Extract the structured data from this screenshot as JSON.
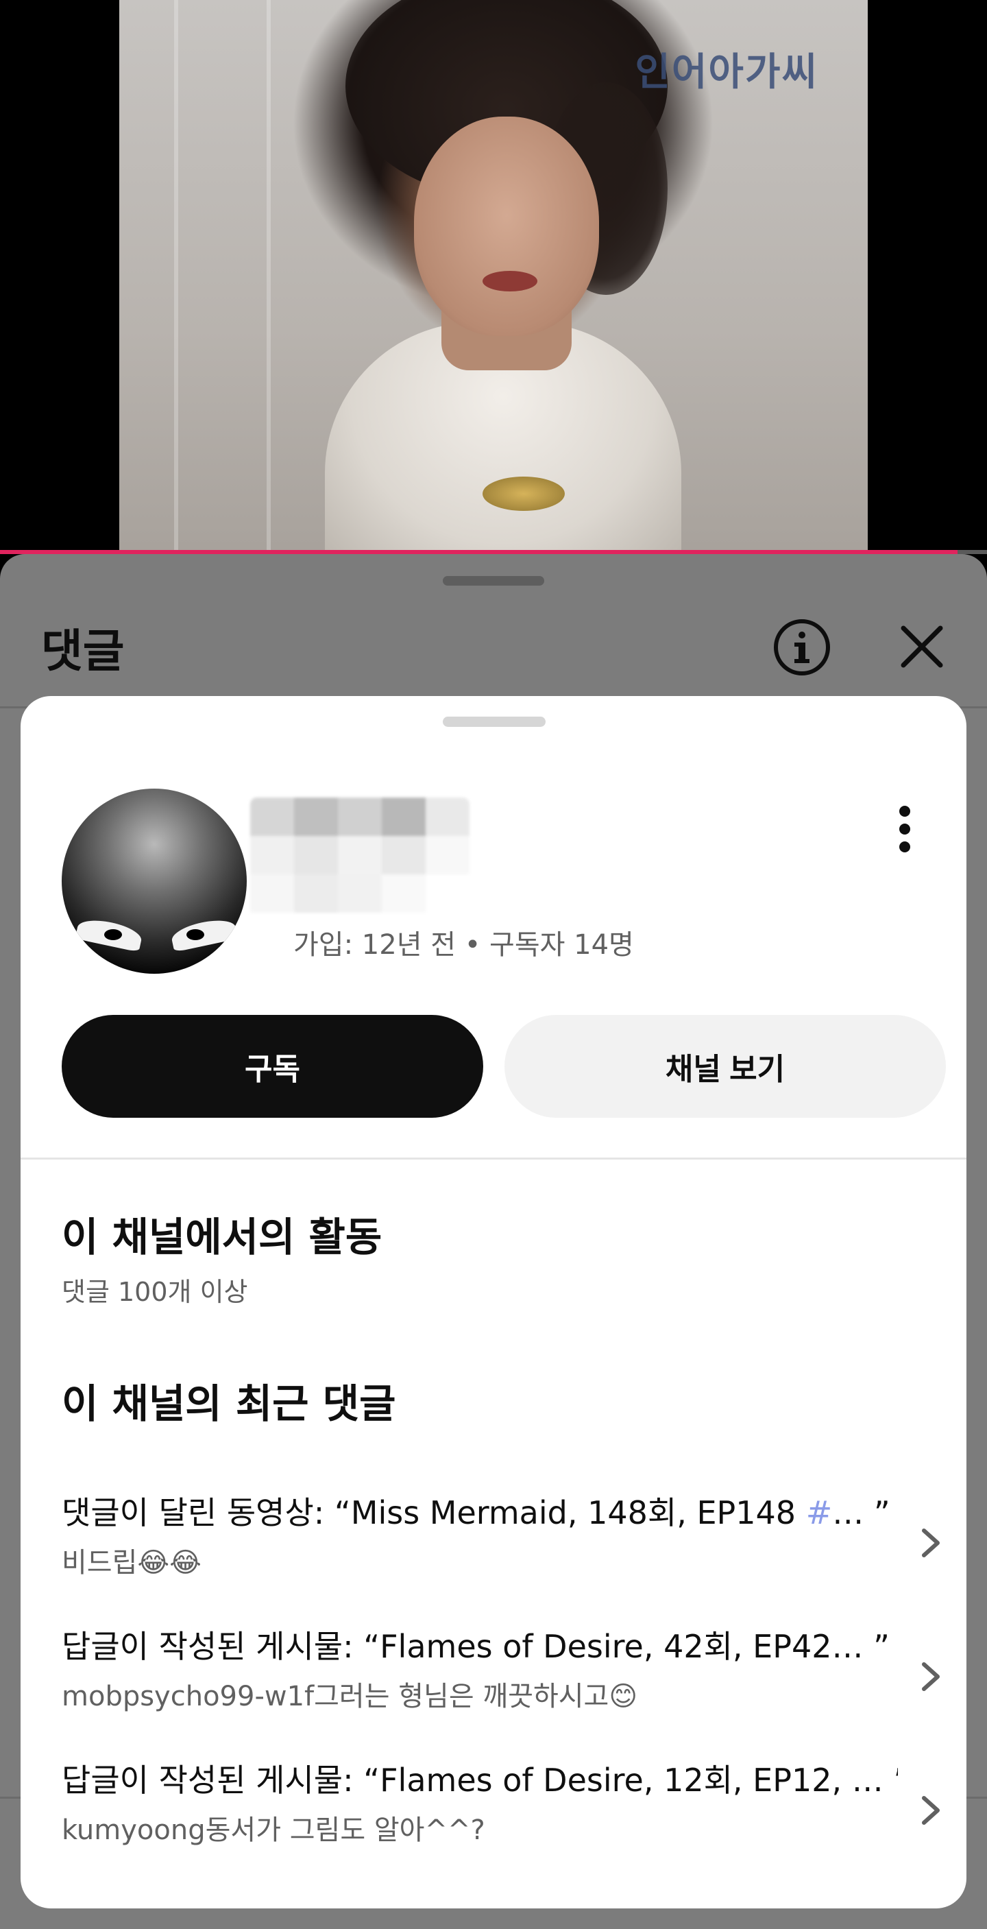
{
  "video": {
    "watermark": "인어아가씨",
    "progress_fraction": 0.97
  },
  "comments_sheet": {
    "title": "댓글",
    "info_icon": "info-icon",
    "close_icon": "close-icon"
  },
  "channel_card": {
    "avatar_icon": "avatar",
    "meta": "가입: 12년 전 • 구독자 14명",
    "more_icon": "more-vert-icon",
    "subscribe_label": "구독",
    "view_channel_label": "채널 보기",
    "activity_title": "이 채널에서의 활동",
    "activity_sub": "댓글 100개 이상",
    "recent_title": "이 채널의 최근 댓글",
    "recent_comments": [
      {
        "line1_prefix": "댓글이 달린 동영상: “Miss Mermaid, 148회, EP148 ",
        "line1_hash": "#",
        "line1_suffix": "…  ”",
        "line2": "비드립😂😂"
      },
      {
        "line1_prefix": "답글이 작성된 게시물: “Flames of Desire, 42회, EP42… ”",
        "line1_hash": "",
        "line1_suffix": "",
        "line2": "mobpsycho99-w1f그러는 형님은 깨끗하시고😊"
      },
      {
        "line1_prefix": "답글이 작성된 게시물: “Flames of Desire, 12회, EP12, … ”",
        "line1_hash": "",
        "line1_suffix": "",
        "line2": "kumyoong동서가 그림도 알아^^?"
      }
    ]
  },
  "colors": {
    "progress": "#e0245e",
    "subscribe_bg": "#0f0f0f",
    "hashtag": "#8a9be8"
  }
}
